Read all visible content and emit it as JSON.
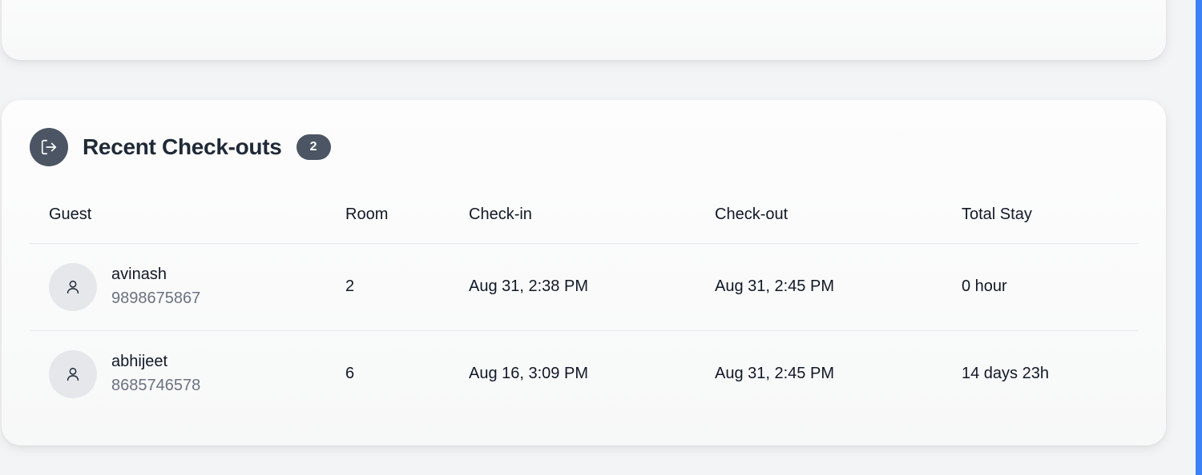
{
  "section": {
    "title": "Recent Check-outs",
    "count": "2",
    "icon": "logout-icon"
  },
  "table": {
    "headers": {
      "guest": "Guest",
      "room": "Room",
      "checkin": "Check-in",
      "checkout": "Check-out",
      "stay": "Total Stay"
    },
    "rows": [
      {
        "name": "avinash",
        "phone": "9898675867",
        "room": "2",
        "checkin": "Aug 31, 2:38 PM",
        "checkout": "Aug 31, 2:45 PM",
        "stay": "0 hour",
        "avatar_icon": "user-icon"
      },
      {
        "name": "abhijeet",
        "phone": "8685746578",
        "room": "6",
        "checkin": "Aug 16, 3:09 PM",
        "checkout": "Aug 31, 2:45 PM",
        "stay": "14 days 23h",
        "avatar_icon": "user-icon"
      }
    ]
  },
  "colors": {
    "accent_dark": "#4b5563",
    "scroll_accent": "#3b82f6",
    "muted_text": "#6b7280"
  }
}
